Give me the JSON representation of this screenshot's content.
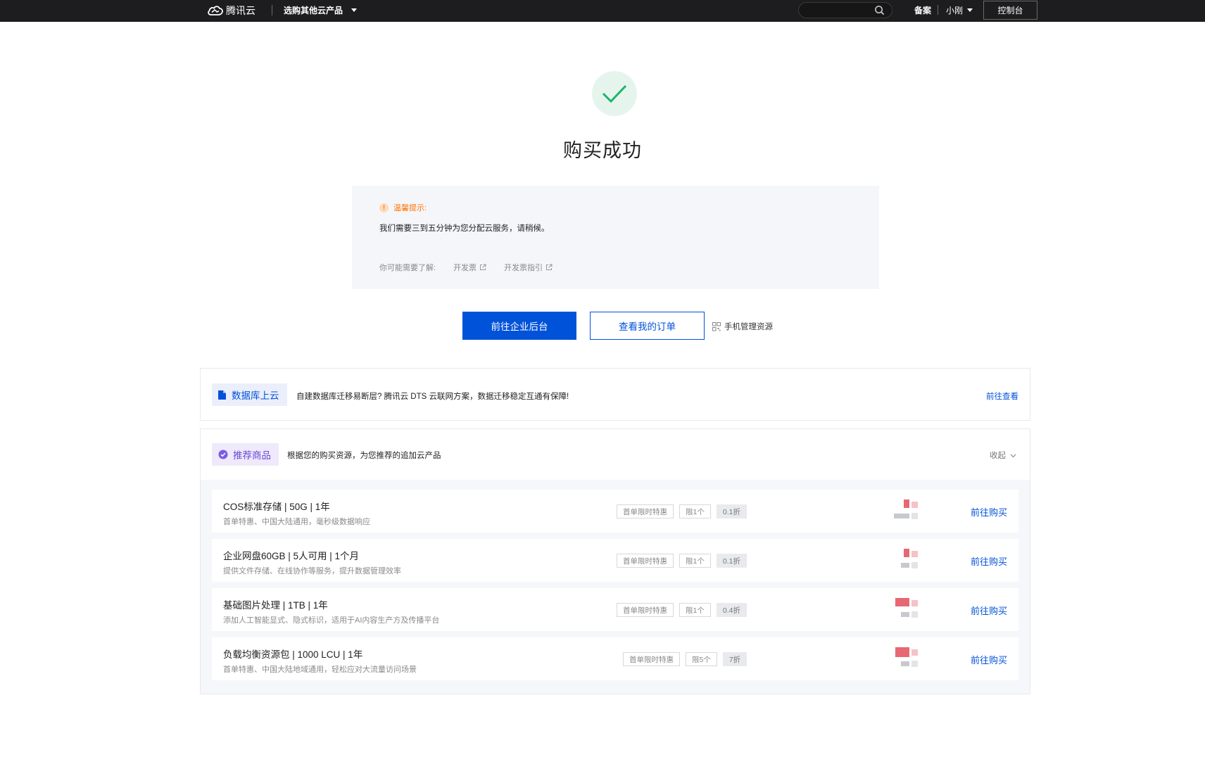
{
  "topbar": {
    "brand": "腾讯云",
    "products_label": "选购其他云产品",
    "search_placeholder": "",
    "beian_label": "备案",
    "user_name": "小刚",
    "console_label": "控制台"
  },
  "success": {
    "title": "购买成功"
  },
  "tip": {
    "heading": "温馨提示:",
    "message": "我们需要三到五分钟为您分配云服务，请稍候。",
    "links_label": "你可能需要了解:",
    "links": [
      "开发票",
      "开发票指引"
    ]
  },
  "actions": {
    "primary_label": "前往企业后台",
    "secondary_label": "查看我的订单",
    "mobile_label": "手机管理资源"
  },
  "db_banner": {
    "tag": "数据库上云",
    "text": "自建数据库迁移易断层? 腾讯云 DTS 云联网方案，数据迁移稳定互通有保障!",
    "link": "前往查看"
  },
  "recommend": {
    "tag": "推荐商品",
    "text": "根据您的购买资源，为您推荐的追加云产品",
    "collapse_label": "收起",
    "items": [
      {
        "name": "COS标准存储 | 50G | 1年",
        "desc": "首单特惠、中国大陆通用，毫秒级数据响应",
        "badges": [
          "首单限时特惠",
          "限1个"
        ],
        "discount": "0.1折",
        "buy_label": "前往购买"
      },
      {
        "name": "企业网盘60GB | 5人可用 | 1个月",
        "desc": "提供文件存储、在线协作等服务，提升数据管理效率",
        "badges": [
          "首单限时特惠",
          "限1个"
        ],
        "discount": "0.1折",
        "buy_label": "前往购买"
      },
      {
        "name": "基础图片处理 | 1TB | 1年",
        "desc": "添加人工智能显式、隐式标识，适用于AI内容生产方及传播平台",
        "badges": [
          "首单限时特惠",
          "限1个"
        ],
        "discount": "0.4折",
        "buy_label": "前往购买"
      },
      {
        "name": "负载均衡资源包 | 1000 LCU | 1年",
        "desc": "首单特惠、中国大陆地域通用，轻松应对大流量访问场景",
        "badges": [
          "首单限时特惠",
          "限5个"
        ],
        "discount": "7折",
        "buy_label": "前往购买"
      }
    ]
  },
  "colors": {
    "primary": "#0052d9",
    "success": "#1fb36b",
    "warning": "#ff7200",
    "topbar": "#1d1d1f"
  }
}
